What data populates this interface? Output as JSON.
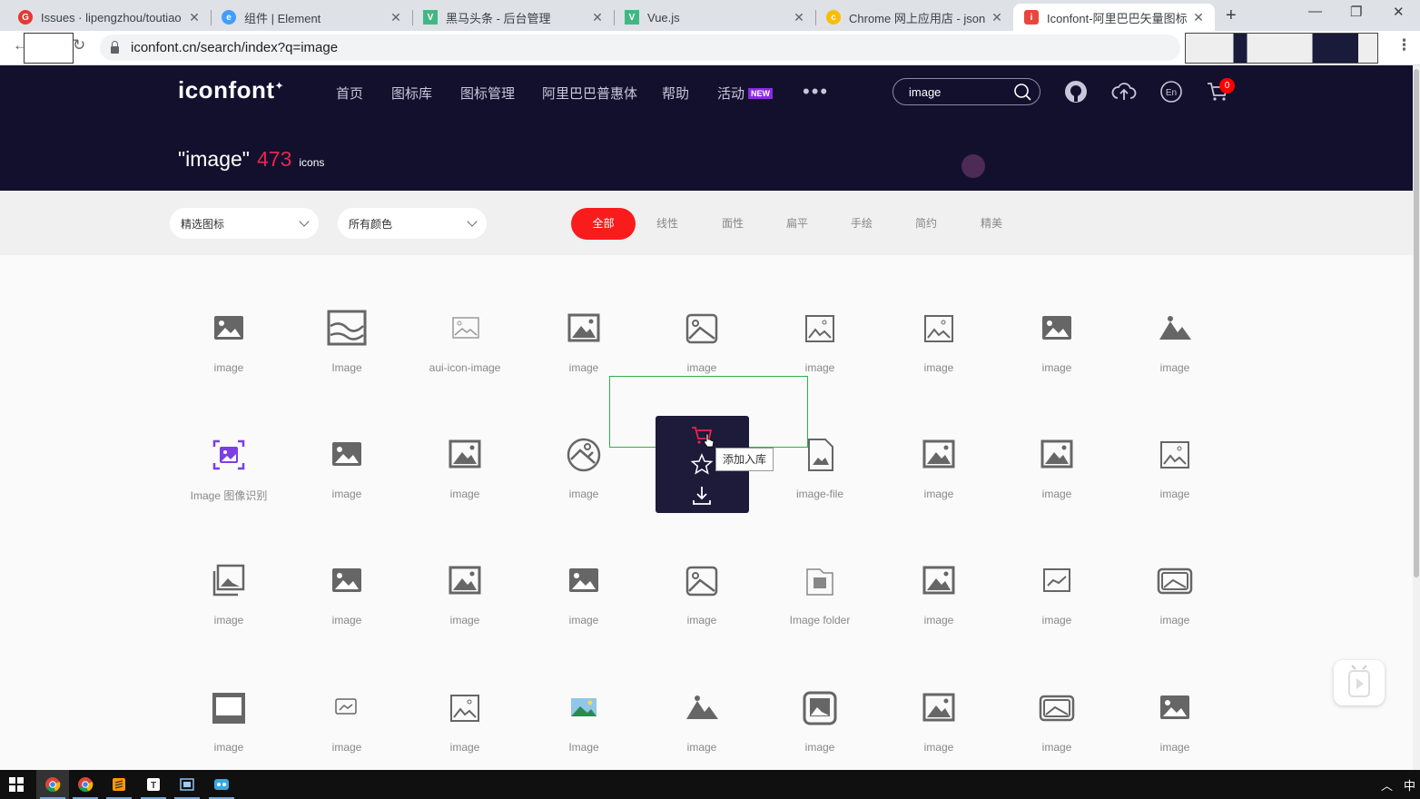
{
  "browser": {
    "tabs": [
      {
        "title": "Issues · lipengzhou/toutiao",
        "favicon": "G",
        "color": "#e53935"
      },
      {
        "title": "组件 | Element",
        "favicon": "e",
        "color": "#409eff"
      },
      {
        "title": "黑马头条 - 后台管理",
        "favicon": "V",
        "color": "#41b883"
      },
      {
        "title": "Vue.js",
        "favicon": "V",
        "color": "#41b883"
      },
      {
        "title": "Chrome 网上应用店 - json",
        "favicon": "c",
        "color": "#fbbc04"
      },
      {
        "title": "Iconfont-阿里巴巴矢量图标",
        "favicon": "i",
        "color": "#e8463a"
      }
    ],
    "close_glyph": "✕",
    "new_tab": "+",
    "url": "iconfont.cn/search/index?q=image"
  },
  "header": {
    "logo": "iconfont",
    "nav": [
      "首页",
      "图标库",
      "图标管理",
      "阿里巴巴普惠体",
      "帮助",
      "活动"
    ],
    "new_badge": "NEW",
    "more": "•••",
    "search_value": "image",
    "cart_count": "0",
    "query": "\"image\"",
    "count": "473",
    "unit": "icons"
  },
  "filters": {
    "select_1": "精选图标",
    "select_2": "所有颜色",
    "categories": [
      "全部",
      "线性",
      "面性",
      "扁平",
      "手绘",
      "简约",
      "精美"
    ]
  },
  "icons": [
    [
      "image",
      "Image",
      "aui-icon-image",
      "image",
      "image",
      "image",
      "image",
      "image",
      "image"
    ],
    [
      "Image 图像识别",
      "image",
      "image",
      "image",
      "",
      "image-file",
      "image",
      "image",
      "image"
    ],
    [
      "image",
      "image",
      "image",
      "image",
      "image",
      "Image folder",
      "image",
      "image",
      "image"
    ],
    [
      "image",
      "image",
      "image",
      "Image",
      "image",
      "image",
      "image",
      "image",
      "image"
    ]
  ],
  "hover": {
    "tooltip": "添加入库"
  },
  "colors": {
    "header_bg": "#13102e",
    "accent": "#fa1c1c",
    "icon": "#666666",
    "purple": "#7b3fe4"
  },
  "taskbar": {
    "ime": "中"
  }
}
